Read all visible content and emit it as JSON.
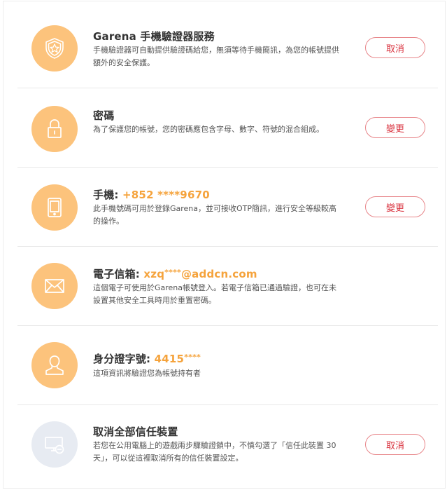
{
  "items": [
    {
      "title": "Garena 手機驗證器服務",
      "desc": "手機驗證器可自動提供驗證碼給您，無須等待手機簡訊，為您的帳號提供額外的安全保護。",
      "button": "取消",
      "icon": "shield-icon"
    },
    {
      "title": "密碼",
      "desc": "為了保護您的帳號，您的密碼應包含字母、數字、符號的混合組成。",
      "button": "變更",
      "icon": "lock-icon"
    },
    {
      "title_prefix": "手機: ",
      "title_value": "+852 ****9670",
      "desc": "此手機號碼可用於登錄Garena，並可接收OTP簡訊，進行安全等級較高的操作。",
      "button": "變更",
      "icon": "tablet-icon"
    },
    {
      "title_prefix": "電子信箱: ",
      "title_value_a": "xzq",
      "title_value_mask": "****",
      "title_value_b": "@addcn.com",
      "desc": "這個電子可使用於Garena帳號登入。若電子信箱已通過驗證，也可在未設置其他安全工具時用於重置密碼。",
      "icon": "envelope-icon"
    },
    {
      "title_prefix": "身分證字號: ",
      "title_value_a": "4415",
      "title_value_mask": "****",
      "desc": "這項資訊將驗證您為帳號持有者",
      "icon": "user-icon"
    },
    {
      "title": "取消全部信任裝置",
      "desc": "若您在公用電腦上的遊戲兩步驟驗證鎖中，不慎勾選了「信任此裝置 30 天」，可以從這裡取消所有的信任裝置設定。",
      "button": "取消",
      "icon": "device-remove-icon"
    }
  ],
  "colors": {
    "accent": "#f5a33c",
    "icon_bg": "#fcc37c",
    "icon_bg_disabled": "#e7ebf2",
    "button_text": "#d9333f",
    "button_border": "#e8878b"
  }
}
